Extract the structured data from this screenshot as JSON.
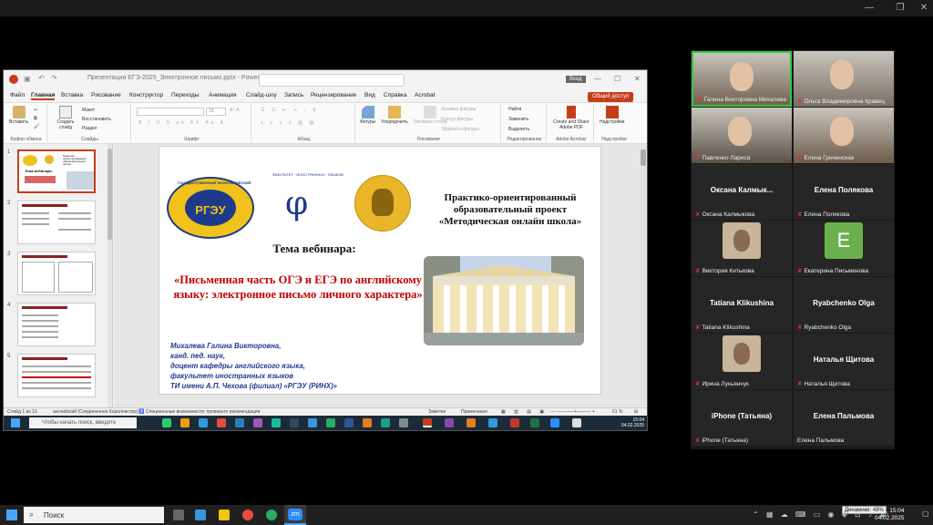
{
  "ppt": {
    "title": "Презентация ЕГЭ-2025_Электронное письмо.pptx - PowerPoint",
    "sign_in": "Вход",
    "menu": [
      "Файл",
      "Главная",
      "Вставка",
      "Рисование",
      "Конструктор",
      "Переходы",
      "Анимация",
      "Слайд-шоу",
      "Запись",
      "Рецензирование",
      "Вид",
      "Справка",
      "Acrobat"
    ],
    "share": "Общий доступ",
    "ribbon": {
      "paste": "Вставить",
      "clipboard": "Буфер обмена",
      "create_slide": "Создать слайд",
      "layout": "Макет",
      "reset": "Восстановить",
      "section": "Раздел",
      "slides": "Слайды",
      "font": "Шрифт",
      "paragraph": "Абзац",
      "figures": "Фигуры",
      "arrange": "Упорядочить",
      "express_styles": "Экспресс-стили",
      "fill": "Заливка фигуры",
      "outline": "Контур фигуры",
      "effects": "Эффекты фигуры",
      "drawing": "Рисование",
      "find": "Найти",
      "replace": "Заменить",
      "select": "Выделить",
      "editing": "Редактирование",
      "create_share": "Create and Share Adobe PDF",
      "acrobat": "Adobe Acrobat",
      "addins": "Надстройки",
      "addins_group": "Надстройки",
      "font_size": "18"
    },
    "slide_numbers": [
      "1",
      "2",
      "3",
      "4",
      "5"
    ],
    "slide": {
      "project": "Практико-ориентированный образовательный проект «Методическая онлайн школа»",
      "topic_label": "Тема вебинара:",
      "topic": "«Письменная часть ОГЭ и ЕГЭ по английскому языку: электронное письмо личного характера»",
      "author_lines": [
        "Михалева Галина Викторовна,",
        "канд. пед. наук,",
        "доцент кафедры английского языка,",
        "факультет иностранных языков",
        "ТИ имени А.П. Чехова (филиал) «РГЭУ (РИНХ)»"
      ],
      "logo_text": "РГЭУ",
      "logo_ring_top": "ГОСУДАРСТВЕННЫЙ ЭКОНОМИЧЕСКИЙ",
      "fac_ring": "ФАКУЛЬТЕТ · ИНОСТРАННЫХ · ЯЗЫКОВ"
    },
    "thumb1": {
      "title": "Тема вебинара:",
      "project": "Практико-ориентированный образовательный проект"
    },
    "status": {
      "slide_of": "Слайд 1 из 13",
      "language": "английский (Соединенное Королевство)",
      "accessibility": "Специальные возможности: проверьте рекомендации",
      "notes": "Заметки",
      "comments": "Примечания",
      "zoom": "61 %"
    },
    "taskbar": {
      "search": "Чтобы начать поиск, введите",
      "time": "15:04",
      "date": "04.02.2025"
    }
  },
  "zoom": {
    "participants": [
      {
        "name": "Галина Викторовна Михалева",
        "type": "video",
        "speaking": true
      },
      {
        "name": "Ольга Владимировна Кравец",
        "type": "video"
      },
      {
        "name": "Павленко Лариса",
        "type": "video"
      },
      {
        "name": "Елена Гречинская",
        "type": "video"
      },
      {
        "name": "Оксана Калмыкова",
        "type": "text",
        "display": "Оксана Калмык..."
      },
      {
        "name": "Елена Полякова",
        "type": "text",
        "display": "Елена Полякова"
      },
      {
        "name": "Виктория Китькова",
        "type": "avatar"
      },
      {
        "name": "Екатерина Письменова",
        "type": "letter",
        "letter": "E"
      },
      {
        "name": "Tatiana Klikushina",
        "type": "text",
        "display": "Tatiana Klikushina"
      },
      {
        "name": "Ryabchenko Olga",
        "type": "text",
        "display": "Ryabchenko Olga"
      },
      {
        "name": "Ирина Лукьянчук",
        "type": "avatar"
      },
      {
        "name": "Наталья Щитова",
        "type": "text",
        "display": "Наталья Щитова"
      },
      {
        "name": "iPhone (Татьяна)",
        "type": "text",
        "display": "iPhone (Татьяна)"
      },
      {
        "name": "Елена Пальмова",
        "type": "text",
        "display": "Елена Пальмова",
        "muted": false
      }
    ]
  },
  "host": {
    "search": "Поиск",
    "tooltip": "Динамики: 49%",
    "time": "15:04",
    "date": "04.02.2025",
    "zoom_app": "zm"
  },
  "colors": {
    "accent": "#c43e1c",
    "speaker": "#2ecc40",
    "title_red": "#c00000",
    "author_blue": "#1f3a93"
  }
}
